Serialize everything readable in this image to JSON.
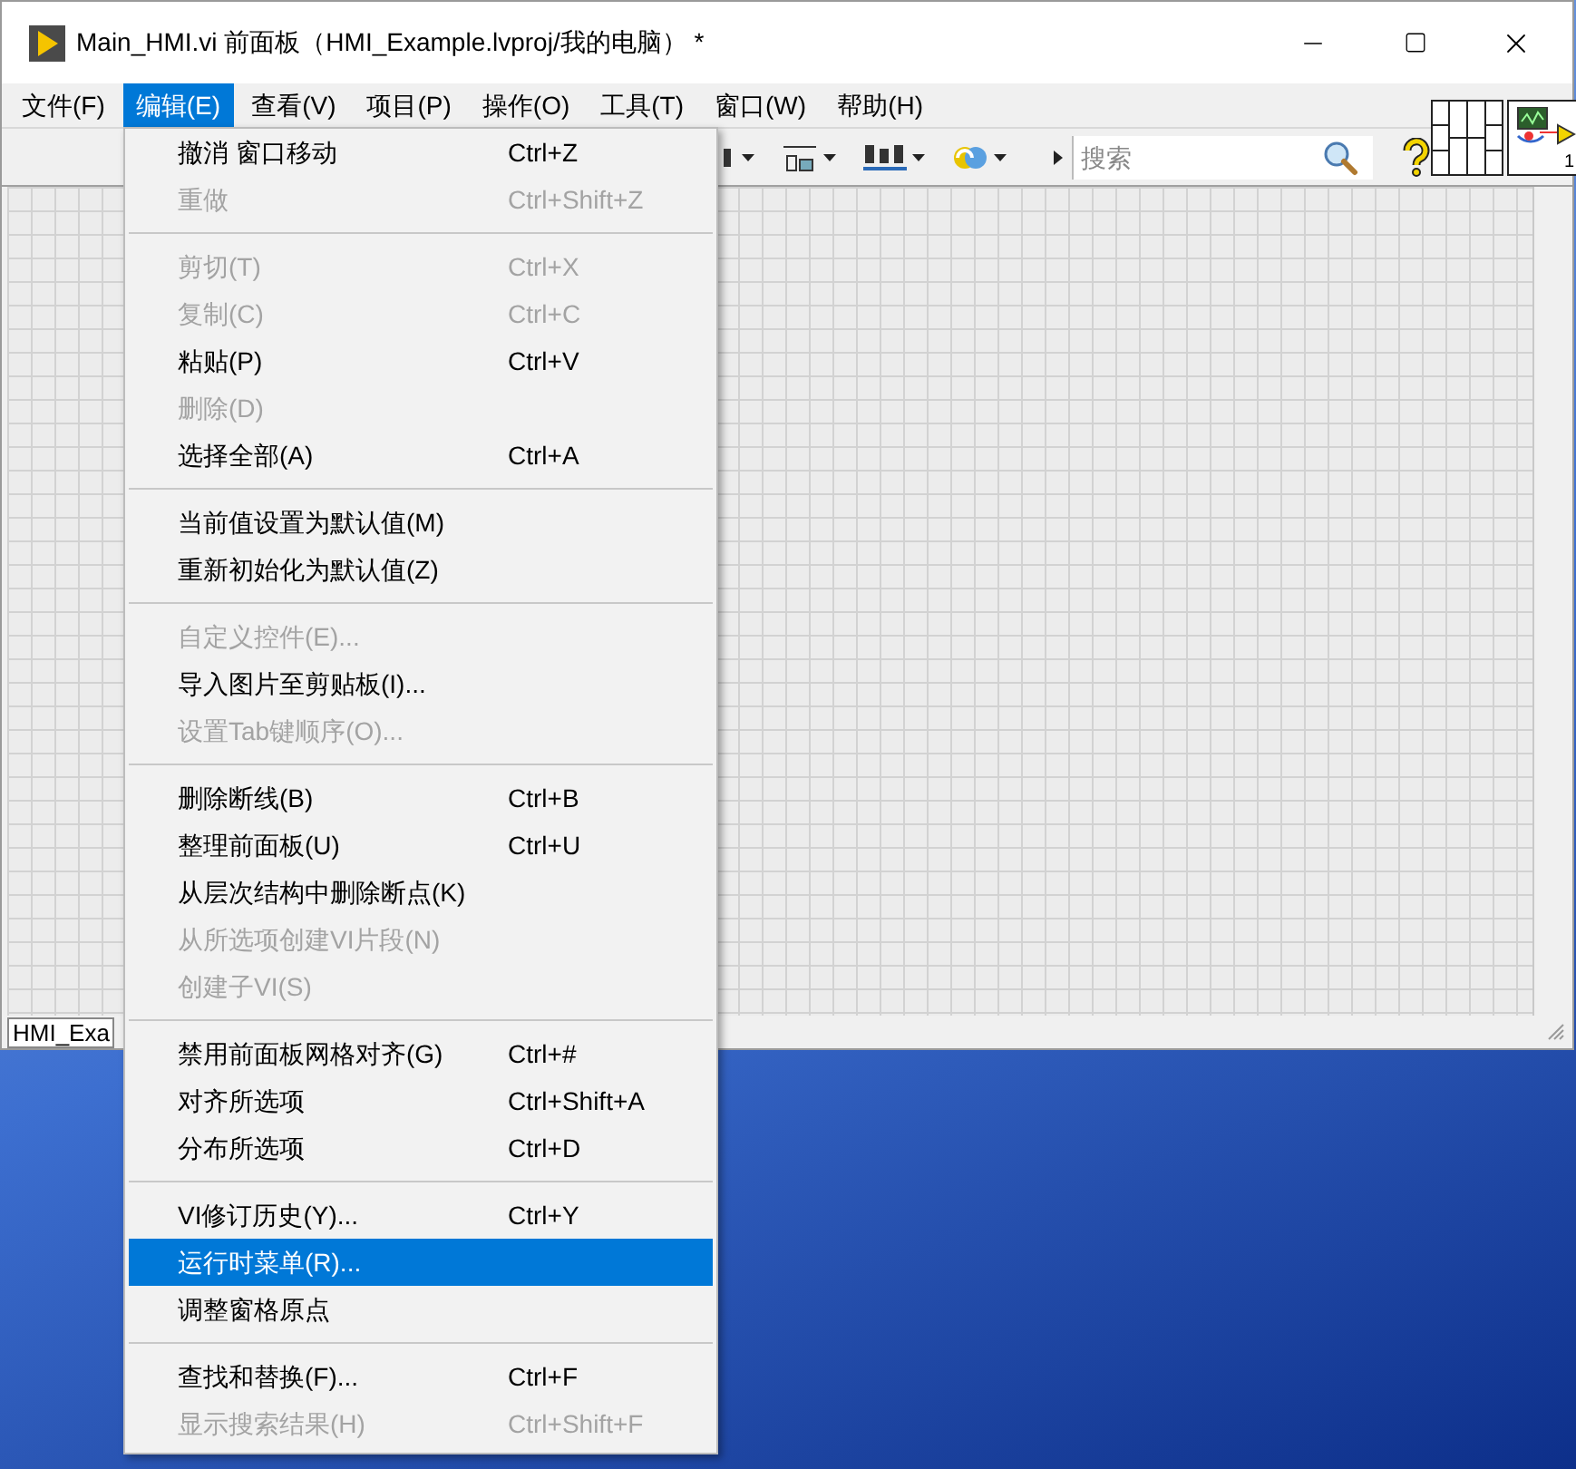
{
  "window": {
    "title": "Main_HMI.vi 前面板（HMI_Example.lvproj/我的电脑） *"
  },
  "menu_bar": [
    {
      "label": "文件(F)",
      "selected": false
    },
    {
      "label": "编辑(E)",
      "selected": true
    },
    {
      "label": "查看(V)",
      "selected": false
    },
    {
      "label": "项目(P)",
      "selected": false
    },
    {
      "label": "操作(O)",
      "selected": false
    },
    {
      "label": "工具(T)",
      "selected": false
    },
    {
      "label": "窗口(W)",
      "selected": false
    },
    {
      "label": "帮助(H)",
      "selected": false
    }
  ],
  "toolbar": {
    "search": {
      "placeholder": "搜索"
    }
  },
  "vi_icon": {
    "number": "1"
  },
  "status_bar": {
    "text": "HMI_Exa"
  },
  "edit_menu": {
    "groups": [
      [
        {
          "label": "撤消 窗口移动",
          "shortcut": "Ctrl+Z",
          "disabled": false,
          "selected": false
        },
        {
          "label": "重做",
          "shortcut": "Ctrl+Shift+Z",
          "disabled": true,
          "selected": false
        }
      ],
      [
        {
          "label": "剪切(T)",
          "shortcut": "Ctrl+X",
          "disabled": true,
          "selected": false
        },
        {
          "label": "复制(C)",
          "shortcut": "Ctrl+C",
          "disabled": true,
          "selected": false
        },
        {
          "label": "粘贴(P)",
          "shortcut": "Ctrl+V",
          "disabled": false,
          "selected": false
        },
        {
          "label": "删除(D)",
          "disabled": true,
          "selected": false
        },
        {
          "label": "选择全部(A)",
          "shortcut": "Ctrl+A",
          "disabled": false,
          "selected": false
        }
      ],
      [
        {
          "label": "当前值设置为默认值(M)",
          "disabled": false,
          "selected": false
        },
        {
          "label": "重新初始化为默认值(Z)",
          "disabled": false,
          "selected": false
        }
      ],
      [
        {
          "label": "自定义控件(E)...",
          "disabled": true,
          "selected": false
        },
        {
          "label": "导入图片至剪贴板(I)...",
          "disabled": false,
          "selected": false
        },
        {
          "label": "设置Tab键顺序(O)...",
          "disabled": true,
          "selected": false
        }
      ],
      [
        {
          "label": "删除断线(B)",
          "shortcut": "Ctrl+B",
          "disabled": false,
          "selected": false
        },
        {
          "label": "整理前面板(U)",
          "shortcut": "Ctrl+U",
          "disabled": false,
          "selected": false
        },
        {
          "label": "从层次结构中删除断点(K)",
          "disabled": false,
          "selected": false
        },
        {
          "label": "从所选项创建VI片段(N)",
          "disabled": true,
          "selected": false
        },
        {
          "label": "创建子VI(S)",
          "disabled": true,
          "selected": false
        }
      ],
      [
        {
          "label": "禁用前面板网格对齐(G)",
          "shortcut": "Ctrl+#",
          "disabled": false,
          "selected": false
        },
        {
          "label": "对齐所选项",
          "shortcut": "Ctrl+Shift+A",
          "disabled": false,
          "selected": false
        },
        {
          "label": "分布所选项",
          "shortcut": "Ctrl+D",
          "disabled": false,
          "selected": false
        }
      ],
      [
        {
          "label": "VI修订历史(Y)...",
          "shortcut": "Ctrl+Y",
          "disabled": false,
          "selected": false
        },
        {
          "label": "运行时菜单(R)...",
          "disabled": false,
          "selected": true
        },
        {
          "label": "调整窗格原点",
          "disabled": false,
          "selected": false
        }
      ],
      [
        {
          "label": "查找和替换(F)...",
          "shortcut": "Ctrl+F",
          "disabled": false,
          "selected": false
        },
        {
          "label": "显示搜索结果(H)",
          "shortcut": "Ctrl+Shift+F",
          "disabled": true,
          "selected": false
        }
      ]
    ]
  }
}
